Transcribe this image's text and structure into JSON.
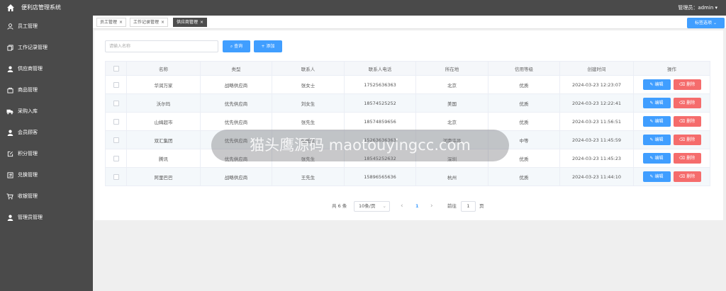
{
  "header": {
    "app_title": "便利店管理系统",
    "admin_label": "管理员：admin ▾"
  },
  "sidebar": {
    "items": [
      {
        "label": "员工管理",
        "icon": "user-icon"
      },
      {
        "label": "工作记录管理",
        "icon": "copy-icon"
      },
      {
        "label": "供应商管理",
        "icon": "user-solid-icon"
      },
      {
        "label": "商品管理",
        "icon": "goods-icon"
      },
      {
        "label": "采购入库",
        "icon": "truck-icon"
      },
      {
        "label": "会员顾客",
        "icon": "user-solid-icon"
      },
      {
        "label": "积分管理",
        "icon": "edit-square-icon"
      },
      {
        "label": "兑换管理",
        "icon": "exchange-icon"
      },
      {
        "label": "收银管理",
        "icon": "cart-icon"
      },
      {
        "label": "管理员管理",
        "icon": "user-solid-icon"
      }
    ]
  },
  "tabs": [
    {
      "label": "员工管理",
      "active": false
    },
    {
      "label": "工作记录管理",
      "active": false
    },
    {
      "label": "供应商管理",
      "active": true
    }
  ],
  "tag_options_label": "标签选项 ⌄",
  "toolbar": {
    "search_placeholder": "请输入名称",
    "query_label": "查询",
    "add_label": "+ 添加"
  },
  "table": {
    "headers": [
      "名称",
      "类型",
      "联系人",
      "联系人电话",
      "所在地",
      "信用等级",
      "创建时间",
      "操作"
    ],
    "rows": [
      [
        "华润万家",
        "战略供应商",
        "张女士",
        "17525636363",
        "北京",
        "优质",
        "2024-03-23 12:23:07"
      ],
      [
        "沃尔玛",
        "优先供应商",
        "刘女生",
        "18574525252",
        "美国",
        "优质",
        "2024-03-23 12:22:41"
      ],
      [
        "山姆超市",
        "优先供应商",
        "张先生",
        "18574859656",
        "北京",
        "优质",
        "2024-03-23 11:56:51"
      ],
      [
        "双汇集团",
        "优先供应商",
        "张先生",
        "15263636363",
        "河南许昌",
        "中等",
        "2024-03-23 11:45:59"
      ],
      [
        "腾讯",
        "优先供应商",
        "张先生",
        "18545252632",
        "深圳",
        "优质",
        "2024-03-23 11:45:23"
      ],
      [
        "阿里巴巴",
        "战略供应商",
        "王先生",
        "15896565636",
        "杭州",
        "优质",
        "2024-03-23 11:44:10"
      ]
    ],
    "edit_label": "✎ 编辑",
    "delete_label": "⌫ 删除"
  },
  "pagination": {
    "total": "共 6 条",
    "page_size": "10条/页",
    "prev": "‹",
    "current_page": "1",
    "next": "›",
    "goto_label": "前往",
    "goto_value": "1",
    "page_unit": "页"
  },
  "watermark": {
    "text": "猫头鹰源码 maotouyingcc.com"
  },
  "colors": {
    "sidebar_bg": "#4a4a4a",
    "primary": "#409eff",
    "danger": "#f56c6c"
  }
}
